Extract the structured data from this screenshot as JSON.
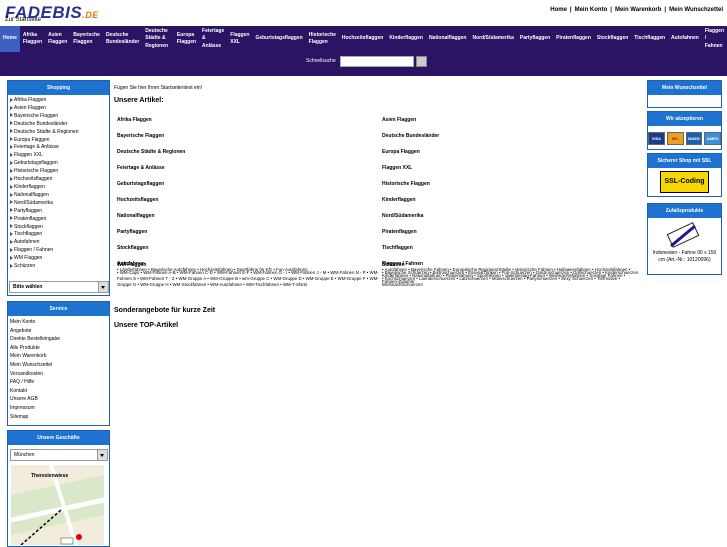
{
  "logo": {
    "main": "FADEBIS",
    "suffix": ".DE",
    "subtitle": "Zur Startseite"
  },
  "topnav": [
    "Home",
    "Mein Konto",
    "Mein Warenkorb",
    "Mein Wunschzettel"
  ],
  "navbar": [
    "Home",
    "Afrika Flaggen",
    "Asien Flaggen",
    "Bayerische Flaggen",
    "Deutsche Bundesländer",
    "Deutsche Städte & Regionen",
    "Europa Flaggen",
    "Feiertage & Anlässe",
    "Flaggen XXL",
    "Geburtstagsflaggen",
    "Historische Flaggen",
    "Hochzeitsflaggen",
    "Kinderflaggen",
    "Nationalflaggen",
    "Nord/Südamerika",
    "Partyflaggen",
    "Piratenflaggen",
    "Stockflaggen",
    "Tischflaggen",
    "Autofahnen",
    "Flaggen / Fahnen"
  ],
  "search": {
    "label": "Schnellsuche",
    "value": ""
  },
  "shopping": {
    "title": "Shopping",
    "items": [
      "Afrika Flaggen",
      "Asien Flaggen",
      "Bayerische Flaggen",
      "Deutsche Bundesländer",
      "Deutsche Städte & Regionen",
      "Europa Flaggen",
      "Feiertage & Anlässe",
      "Flaggen XXL",
      "Geburtstagsflaggen",
      "Historische Flaggen",
      "Hochzeitsflaggen",
      "Kinderflaggen",
      "Nationalflaggen",
      "Nord/Südamerika",
      "Partyflaggen",
      "Piratenflaggen",
      "Stockflaggen",
      "Tischflaggen",
      "Autofahnen",
      "Flaggen / Fahnen",
      "WM Flaggen",
      "Schürzen"
    ],
    "select": "Bitte wählen"
  },
  "service": {
    "title": "Service",
    "items": [
      "Mein Konto",
      "Angebote",
      "Direkte Bestelleingabe",
      "Alle Produkte",
      "Mein Warenkorb",
      "Mein Wunschzettel",
      "Versandkosten",
      "FAQ / Hilfe",
      "Kontakt",
      "Unsere AGB",
      "Impressum",
      "Sitemap"
    ]
  },
  "stores": {
    "title": "Unsere Geschäfte",
    "select": "München",
    "map_label": "Theresienwiese"
  },
  "main": {
    "intro": "Fügen Sie hier Ihren Startseitentext ein!",
    "articles_heading": "Unsere Artikel:",
    "left_col": [
      "Afrika Flaggen",
      "Bayerische Flaggen",
      "Deutsche Städte & Regionen",
      "Feiertage & Anlässe",
      "Geburtstagsflaggen",
      "Hochzeitsflaggen",
      "Nationalflaggen",
      "Partyflaggen",
      "Stockflaggen",
      "Autofahnen"
    ],
    "right_col": [
      "Asien Flaggen",
      "Deutsche Bundesländer",
      "Europa Flaggen",
      "Flaggen XXL",
      "Historische Flaggen",
      "Kinderflaggen",
      "Nord/Südamerika",
      "Piratenflaggen",
      "Tischflaggen",
      "Flaggen / Fahnen"
    ],
    "autofahnen_sub": "• Länderfahnen • Bayerische Autofahnen • Hochzeitsfahnen • Sportfahne für Kfz • Fun-Autofahnen",
    "fahnen_sub": "• Autofahnen • Bayerische Fahnen • Europäische Regionen/Städte • Historische Fahnen • Halloweenfahnen • Hochzeitsfahnen • Kinderfahnen • Nationalfahnen • Piratenfahnen • Sportfahnen • Valentinstag-Fahnen • Weihnachtsfahnen • Sonstige Fahnen • Fahnen-Zubehör",
    "wm_title": "WM Flaggen",
    "wm_sub": "• WM-Caps • WM-Fahnen A-B • WM-Fahnen C-D • WM-Fahnen E-F • WM-Fahnen G - I • WM-Fahnen J - M • WM-Fahnen N - P • WM-Fahnen S • WM-Fahnen T - Z • WM-Gruppe A • WM-Gruppe B • wm-Gruppe C • WM-Gruppe D • WM-Gruppe E • WM-Gruppe F • WM-Gruppe G • WM-Gruppe H • WM-Stockfahnen • WM-Autofahnen • WM-Tischfahnen • WM-T-Shirts",
    "schuerzen_title": "Schürzen",
    "schuerzen_sub": "• Bayerische Schuerzen • Bistroschuerzen • Essen&Trinken • Fun-Schuerzen • Gastroschuerzen • Grillschuerzen • Kinderschuerzen • Kochschuerzen • Laenderschuerzen • Latzschuerzen • Motivschuerzen • Partyschuerzen • Sexy Schuerzen • Tiermotive • Weihnachtschuerzen",
    "offers_heading": "Sonderangebote für kurze Zeit",
    "top_heading": "Unsere TOP-Artikel"
  },
  "right": {
    "wishlist_title": "Mein Wunschzettel",
    "accept_title": "Wir akzeptieren",
    "cards": [
      "VISA",
      "MC",
      "MAES",
      "AMEX"
    ],
    "ssl_title": "Sicherer Shop mit SSL",
    "ssl_badge": "SSL-Coding",
    "random_title": "Zufallsprodukte",
    "random_product": "Indonesien - Fahne 90 x 150 cm (Art.-Nr.: 10120096)"
  },
  "colors": {
    "nav_bg": "#2a1463",
    "box_head": "#1e73d0",
    "logo": "#2a2f8f"
  }
}
